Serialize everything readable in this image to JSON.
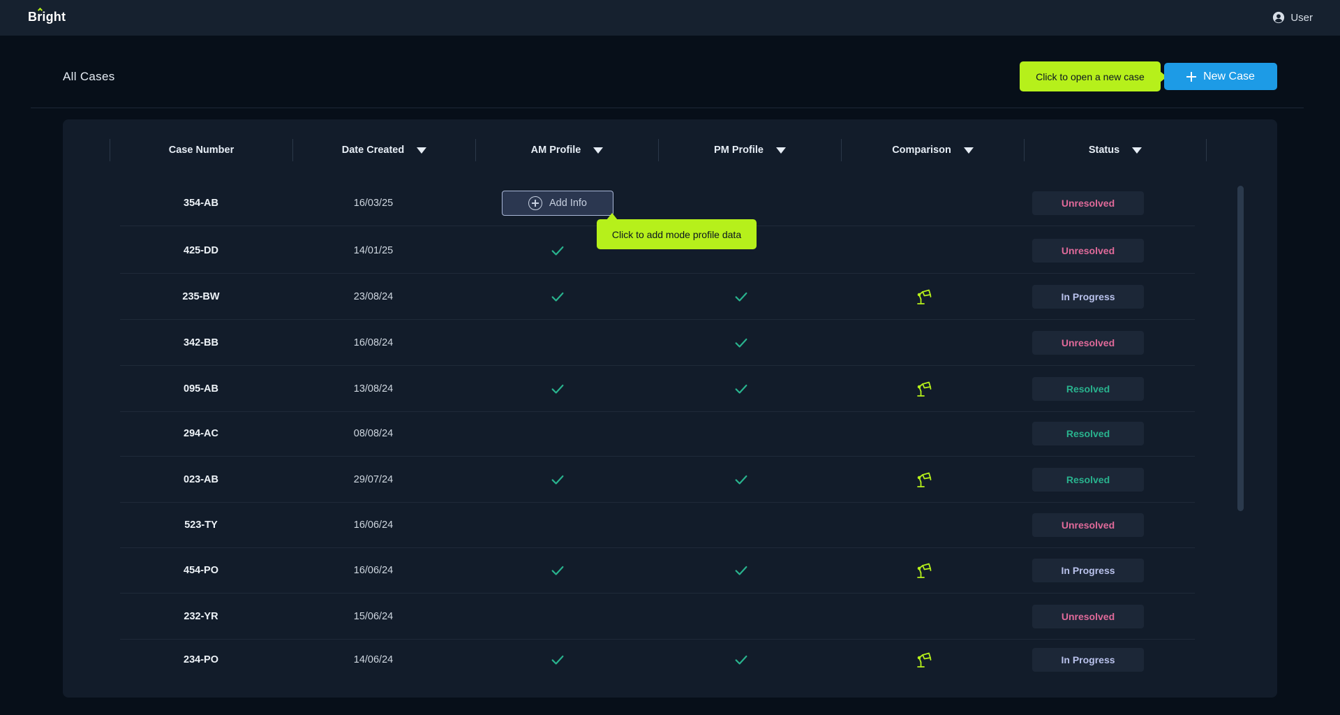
{
  "app": {
    "logo": "Bright"
  },
  "topbar": {
    "user_label": "User"
  },
  "page": {
    "title": "All Cases"
  },
  "actions": {
    "new_case_label": "New Case",
    "new_case_tooltip": "Click to open a new case",
    "add_info_label": "Add Info",
    "add_info_tooltip": "Click to add mode profile data"
  },
  "colors": {
    "accent_lime": "#b6f01b",
    "accent_blue": "#1d9be6",
    "status_unresolved": "#e06a9a",
    "status_in_progress": "#b9c2ec",
    "status_resolved": "#29b38e",
    "check": "#29b38e"
  },
  "table": {
    "columns": [
      "Case Number",
      "Date Created",
      "AM Profile",
      "PM Profile",
      "Comparison",
      "Status"
    ],
    "rows": [
      {
        "case": "354-AB",
        "date": "16/03/25",
        "am": "add-info",
        "pm": false,
        "comparison": false,
        "status": "Unresolved"
      },
      {
        "case": "425-DD",
        "date": "14/01/25",
        "am": true,
        "pm": false,
        "comparison": false,
        "status": "Unresolved"
      },
      {
        "case": "235-BW",
        "date": "23/08/24",
        "am": true,
        "pm": true,
        "comparison": true,
        "status": "In Progress"
      },
      {
        "case": "342-BB",
        "date": "16/08/24",
        "am": false,
        "pm": true,
        "comparison": false,
        "status": "Unresolved"
      },
      {
        "case": "095-AB",
        "date": "13/08/24",
        "am": true,
        "pm": true,
        "comparison": true,
        "status": "Resolved"
      },
      {
        "case": "294-AC",
        "date": "08/08/24",
        "am": false,
        "pm": false,
        "comparison": false,
        "status": "Resolved"
      },
      {
        "case": "023-AB",
        "date": "29/07/24",
        "am": true,
        "pm": true,
        "comparison": true,
        "status": "Resolved"
      },
      {
        "case": "523-TY",
        "date": "16/06/24",
        "am": false,
        "pm": false,
        "comparison": false,
        "status": "Unresolved"
      },
      {
        "case": "454-PO",
        "date": "16/06/24",
        "am": true,
        "pm": true,
        "comparison": true,
        "status": "In Progress"
      },
      {
        "case": "232-YR",
        "date": "15/06/24",
        "am": false,
        "pm": false,
        "comparison": false,
        "status": "Unresolved"
      },
      {
        "case": "234-PO",
        "date": "14/06/24",
        "am": true,
        "pm": true,
        "comparison": true,
        "status": "In Progress"
      }
    ]
  },
  "icons": {
    "check": "check-icon",
    "comparison": "desk-lamp-icon",
    "add": "plus-circle-icon",
    "user": "user-circle-icon",
    "sort": "caret-down-icon"
  }
}
